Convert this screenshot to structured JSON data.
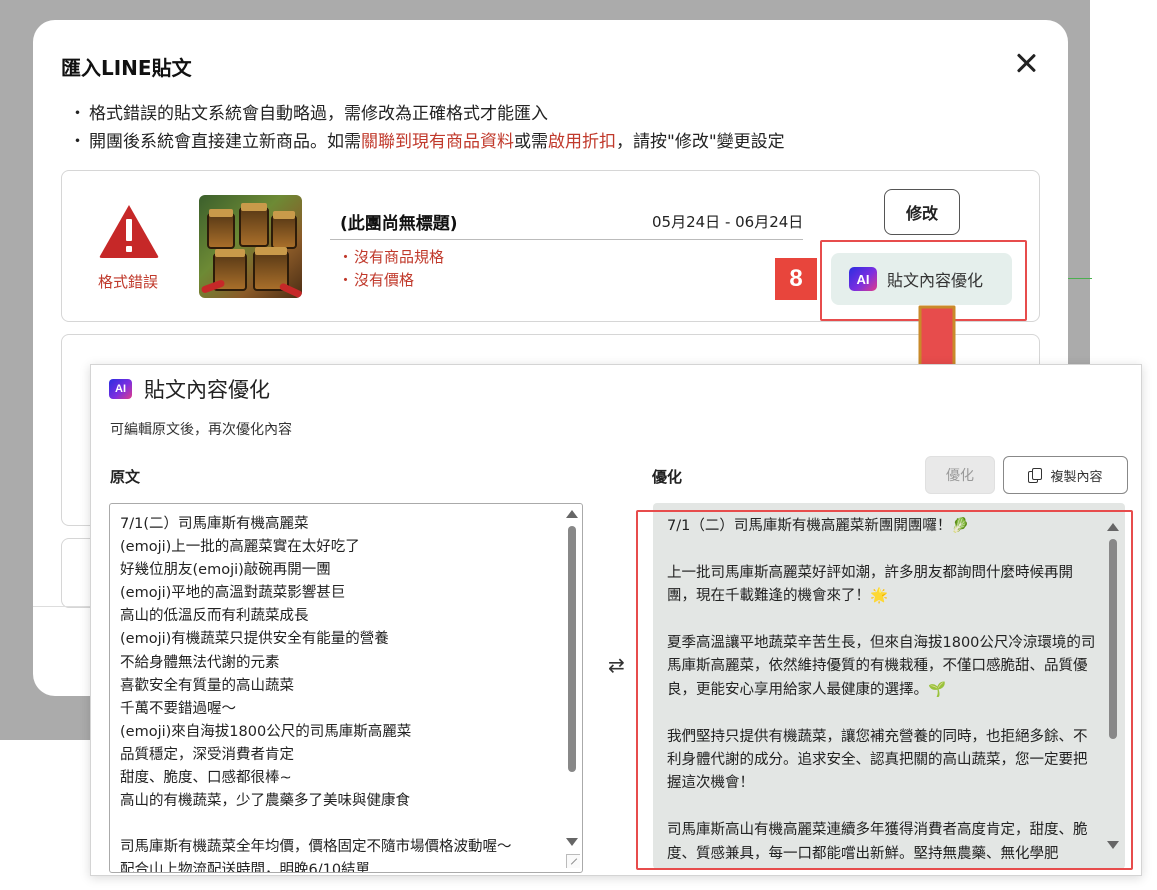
{
  "import_modal": {
    "title": "匯入LINE貼文",
    "notes": {
      "line1": "格式錯誤的貼文系統會自動略過，需修改為正確格式才能匯入",
      "line2_a": "開團後系統會直接建立新商品。如需",
      "line2_link1": "關聯到現有商品資料",
      "line2_b": "或需",
      "line2_link2": "啟用折扣",
      "line2_c": "，請按\"修改\"變更設定"
    },
    "bullet": "・",
    "card": {
      "status_label": "格式錯誤",
      "title": "(此團尚無標題)",
      "date_range": "05月24日 - 06月24日",
      "errors": [
        "沒有商品規格",
        "沒有價格"
      ],
      "edit_label": "修改",
      "optimize_label": "貼文內容優化"
    }
  },
  "callout": {
    "step_number": "8",
    "accent_color": "#e74c4c"
  },
  "optimize_panel": {
    "title": "貼文內容優化",
    "ai_badge": "AI",
    "subtitle": "可編輯原文後，再次優化內容",
    "original_label": "原文",
    "optimized_label": "優化",
    "optimize_button": "優化",
    "copy_button": "複製內容",
    "swap_symbol": "⇄",
    "original_text": "7/1(二）司馬庫斯有機高麗菜\n(emoji)上一批的高麗菜實在太好吃了\n好幾位朋友(emoji)敲碗再開一團\n(emoji)平地的高溫對蔬菜影響甚巨\n高山的低溫反而有利蔬菜成長\n(emoji)有機蔬菜只提供安全有能量的營養\n不給身體無法代謝的元素\n喜歡安全有質量的高山蔬菜\n千萬不要錯過喔～\n(emoji)來自海拔1800公尺的司馬庫斯高麗菜\n品質穩定，深受消費者肯定\n甜度、脆度、口感都很棒~\n高山的有機蔬菜，少了農藥多了美味與健康食\n\n司馬庫斯有機蔬菜全年均價，價格固定不隨市場價格波動喔～\n配合山上物流配送時間，明晚6/10結單",
    "optimized_paragraphs": [
      "7/1（二）司馬庫斯有機高麗菜新團開團囉！🥬",
      "上一批司馬庫斯高麗菜好評如潮，許多朋友都詢問什麼時候再開團，現在千載難逢的機會來了！🌟",
      "夏季高溫讓平地蔬菜辛苦生長，但來自海拔1800公尺冷涼環境的司馬庫斯高麗菜，依然維持優質的有機栽種，不僅口感脆甜、品質優良，更能安心享用給家人最健康的選擇。🌱",
      "我們堅持只提供有機蔬菜，讓您補充營養的同時，也拒絕多餘、不利身體代謝的成分。追求安全、認真把關的高山蔬菜，您一定要把握這次機會！",
      "司馬庫斯高山有機高麗菜連續多年獲得消費者高度肯定，甜度、脆度、質感兼具，每一口都能嚐出新鮮。堅持無農藥、無化學肥"
    ]
  }
}
